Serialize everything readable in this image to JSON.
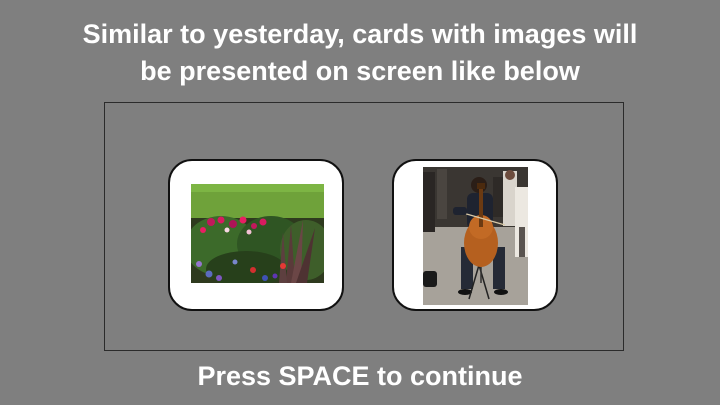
{
  "title": {
    "line1": "Similar to yesterday, cards with images will",
    "line2": "be presented on screen like below"
  },
  "cards": [
    {
      "image_name": "flower-garden-image"
    },
    {
      "image_name": "cellist-playing-image"
    }
  ],
  "prompt": "Press SPACE to continue",
  "colors": {
    "background": "#7f7f7f",
    "text": "#ffffff",
    "card": "#ffffff",
    "frame_border": "#2b2b2b"
  }
}
